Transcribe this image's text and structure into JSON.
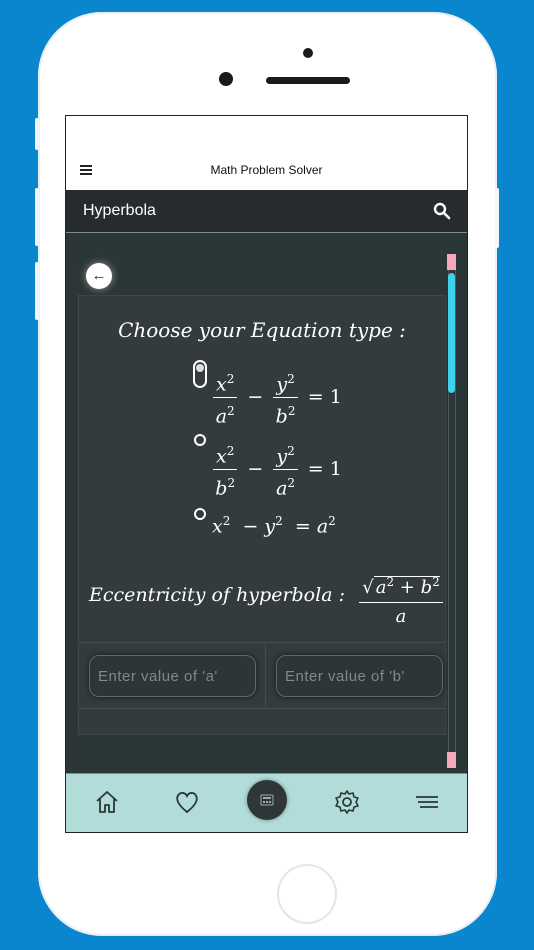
{
  "app": {
    "title": "Math Problem Solver"
  },
  "toolbar": {
    "title": "Hyperbola",
    "search_icon": "search-icon"
  },
  "content": {
    "heading": "Choose your Equation type :",
    "equations": [
      {
        "selected": true,
        "label": "x²/a² − y²/b² = 1"
      },
      {
        "selected": false,
        "label": "x²/b² − y²/a² = 1"
      },
      {
        "selected": false,
        "label": "x² − y² = a²"
      }
    ],
    "eccentricity_label": "Eccentricity of hyperbola :",
    "eccentricity_formula": {
      "numerator": "a² + b²",
      "denominator": "a"
    },
    "inputs": {
      "a_placeholder": "Enter value of 'a'",
      "b_placeholder": "Enter value of 'b'"
    }
  },
  "bottom_nav": {
    "items": [
      "home-icon",
      "heart-icon",
      "calculator-icon",
      "gear-icon",
      "menu-icon"
    ]
  },
  "colors": {
    "toolbar": "#262b2e",
    "content_bg": "#2b3637",
    "bottom_nav": "#b2dcd9",
    "scroll_thumb": "#3fd2ee",
    "scroll_cap": "#f5a9b8",
    "device_bg": "#0a86cf"
  }
}
